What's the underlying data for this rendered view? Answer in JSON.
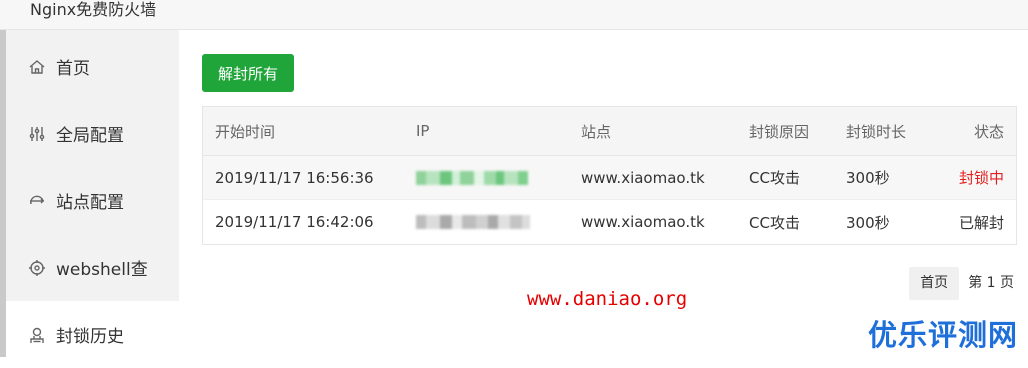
{
  "window": {
    "title": "Nginx免费防火墙"
  },
  "sidebar": {
    "items": [
      {
        "label": "首页",
        "icon": "home-icon"
      },
      {
        "label": "全局配置",
        "icon": "sliders-icon"
      },
      {
        "label": "站点配置",
        "icon": "site-icon"
      },
      {
        "label": "webshell查",
        "icon": "target-icon"
      },
      {
        "label": "封锁历史",
        "icon": "history-icon",
        "active": true
      }
    ]
  },
  "toolbar": {
    "unblock_all_label": "解封所有",
    "accent": "#20a53a"
  },
  "table": {
    "headers": {
      "start_time": "开始时间",
      "ip": "IP",
      "site": "站点",
      "reason": "封锁原因",
      "duration": "封锁时长",
      "status": "状态"
    },
    "rows": [
      {
        "start_time": "2019/11/17 16:56:36",
        "site": "www.xiaomao.tk",
        "reason": "CC攻击",
        "duration": "300秒",
        "status": "封锁中"
      },
      {
        "start_time": "2019/11/17 16:42:06",
        "site": "www.xiaomao.tk",
        "reason": "CC攻击",
        "duration": "300秒",
        "status": "已解封"
      }
    ],
    "status_colors": {
      "blocked": "#e02020",
      "unblocked": "#333333"
    }
  },
  "pagination": {
    "first_label": "首页",
    "page_info": "第 1 页"
  },
  "watermarks": {
    "site_url": "www.daniao.org",
    "brand": "优乐评测网"
  }
}
